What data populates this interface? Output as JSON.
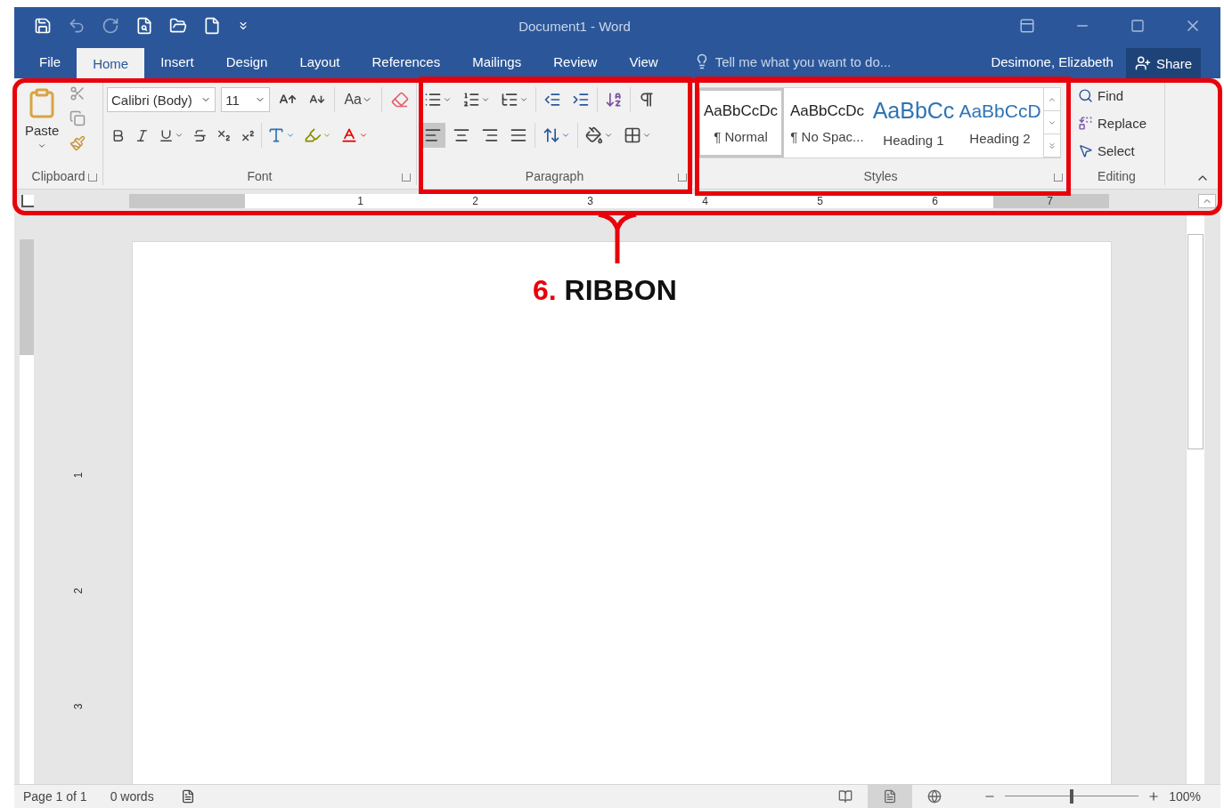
{
  "window": {
    "title": "Document1 - Word"
  },
  "tabs": [
    {
      "label": "File",
      "selected": false
    },
    {
      "label": "Home",
      "selected": true
    },
    {
      "label": "Insert",
      "selected": false
    },
    {
      "label": "Design",
      "selected": false
    },
    {
      "label": "Layout",
      "selected": false
    },
    {
      "label": "References",
      "selected": false
    },
    {
      "label": "Mailings",
      "selected": false
    },
    {
      "label": "Review",
      "selected": false
    },
    {
      "label": "View",
      "selected": false
    }
  ],
  "tell_me": {
    "placeholder": "Tell me what you want to do..."
  },
  "user": "Desimone, Elizabeth",
  "share": "Share",
  "ribbon": {
    "clipboard": {
      "label": "Clipboard",
      "paste": "Paste"
    },
    "font": {
      "label": "Font",
      "name": "Calibri (Body)",
      "size": "11",
      "change_case": "Aa"
    },
    "paragraph": {
      "label": "Paragraph",
      "alignments": [
        {
          "kind": "left",
          "selected": true
        },
        {
          "kind": "center",
          "selected": false
        },
        {
          "kind": "right",
          "selected": false
        },
        {
          "kind": "justify",
          "selected": false
        }
      ]
    },
    "styles": {
      "label": "Styles",
      "items": [
        {
          "kind": "normal",
          "preview": "AaBbCcDc",
          "name": "¶ Normal",
          "selected": true
        },
        {
          "kind": "normal",
          "preview": "AaBbCcDc",
          "name": "¶ No Spac...",
          "selected": false
        },
        {
          "kind": "heading1",
          "preview": "AaBbCc",
          "name": "Heading 1",
          "selected": false
        },
        {
          "kind": "heading2",
          "preview": "AaBbCcD",
          "name": "Heading 2",
          "selected": false
        }
      ]
    },
    "editing": {
      "label": "Editing",
      "items": [
        {
          "kind": "find",
          "label": "Find"
        },
        {
          "kind": "replace",
          "label": "Replace"
        },
        {
          "kind": "select",
          "label": "Select"
        }
      ]
    }
  },
  "ruler": {
    "horizontal": [
      "1",
      "2",
      "3",
      "4",
      "5",
      "6",
      "7"
    ],
    "vertical": [
      "1",
      "2",
      "3"
    ]
  },
  "status_bar": {
    "page": "Page 1 of 1",
    "words": "0 words",
    "views": [
      {
        "kind": "read",
        "selected": false
      },
      {
        "kind": "print",
        "selected": true
      },
      {
        "kind": "web",
        "selected": false
      }
    ],
    "level": 0.5,
    "zoom": "100%"
  },
  "annotation": {
    "number": "6.",
    "label": "RIBBON"
  }
}
